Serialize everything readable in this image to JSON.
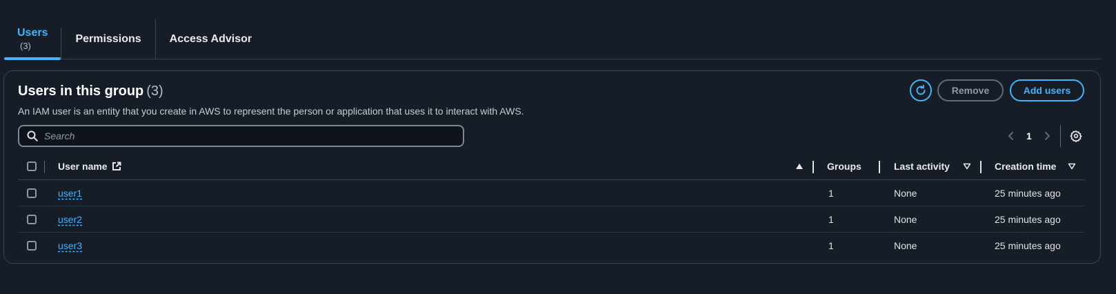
{
  "tabs": [
    {
      "label": "Users",
      "count": "(3)",
      "active": true
    },
    {
      "label": "Permissions"
    },
    {
      "label": "Access Advisor"
    }
  ],
  "panel": {
    "title": "Users in this group",
    "count": "(3)",
    "description": "An IAM user is an entity that you create in AWS to represent the person or application that uses it to interact with AWS.",
    "remove_label": "Remove",
    "add_label": "Add users",
    "search_placeholder": "Search",
    "page_number": "1"
  },
  "table": {
    "columns": [
      "User name",
      "Groups",
      "Last activity",
      "Creation time"
    ],
    "rows": [
      {
        "user": "user1",
        "groups": "1",
        "last_activity": "None",
        "created": "25 minutes ago"
      },
      {
        "user": "user2",
        "groups": "1",
        "last_activity": "None",
        "created": "25 minutes ago"
      },
      {
        "user": "user3",
        "groups": "1",
        "last_activity": "None",
        "created": "25 minutes ago"
      }
    ]
  },
  "colors": {
    "background": "#161d26",
    "accent": "#42b4ff",
    "border": "#3b4450"
  },
  "icons": [
    "refresh-icon",
    "search-icon",
    "chevron-left-icon",
    "chevron-right-icon",
    "settings-gear-icon",
    "external-link-icon",
    "sort-ascending-icon",
    "sort-descending-icon"
  ]
}
